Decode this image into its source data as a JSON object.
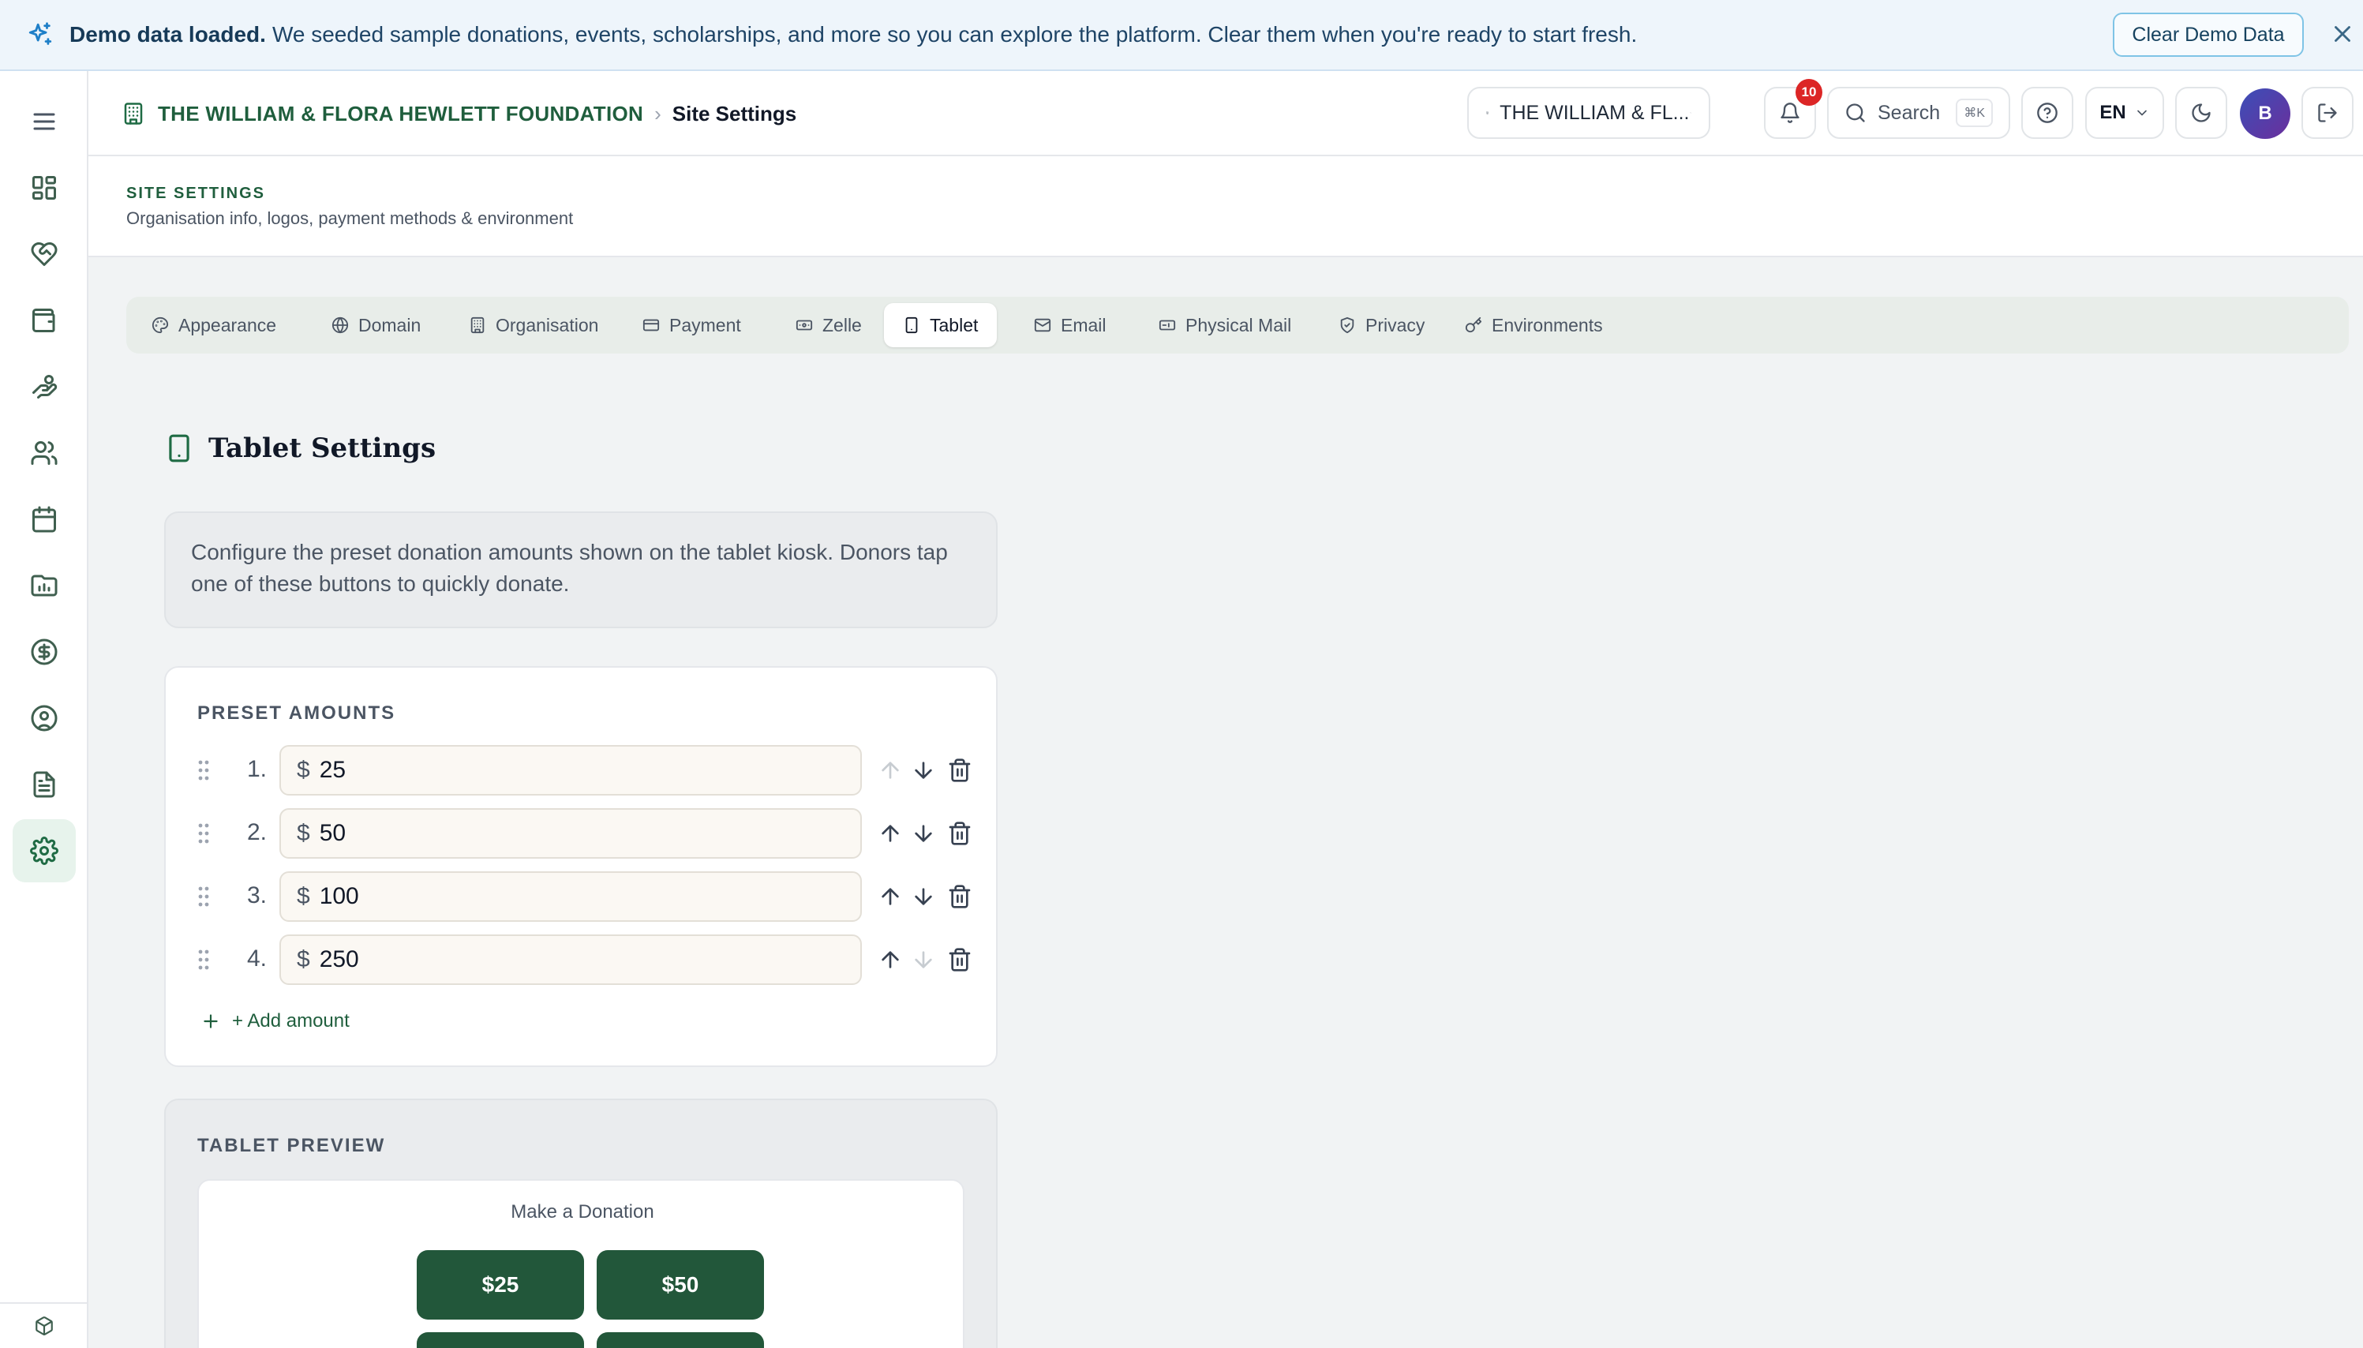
{
  "banner": {
    "title": "Demo data loaded.",
    "message": "We seeded sample donations, events, scholarships, and more so you can explore the platform. Clear them when you're ready to start fresh.",
    "clear_button": "Clear Demo Data"
  },
  "header": {
    "org_name": "THE WILLIAM & FLORA HEWLETT FOUNDATION",
    "separator": "›",
    "page": "Site Settings",
    "org_select": "THE WILLIAM & FL...",
    "notifications_count": "10",
    "search_label": "Search",
    "search_shortcut": "⌘K",
    "language": "EN",
    "avatar_initial": "B"
  },
  "page_header": {
    "title": "SITE SETTINGS",
    "subtitle": "Organisation info, logos, payment methods & environment"
  },
  "tabs": [
    {
      "label": "Appearance",
      "icon": "palette-icon"
    },
    {
      "label": "Domain",
      "icon": "globe-icon"
    },
    {
      "label": "Organisation",
      "icon": "building-icon"
    },
    {
      "label": "Payment",
      "icon": "credit-card-icon"
    },
    {
      "label": "Zelle",
      "icon": "banknote-icon"
    },
    {
      "label": "Tablet",
      "icon": "tablet-icon",
      "active": true
    },
    {
      "label": "Email",
      "icon": "mail-icon"
    },
    {
      "label": "Physical Mail",
      "icon": "mailbox-icon"
    },
    {
      "label": "Privacy",
      "icon": "shield-icon"
    },
    {
      "label": "Environments",
      "icon": "key-icon"
    }
  ],
  "tablet": {
    "title": "Tablet Settings",
    "description": "Configure the preset donation amounts shown on the tablet kiosk. Donors tap one of these buttons to quickly donate.",
    "preset_label": "PRESET AMOUNTS",
    "currency": "$",
    "amounts": [
      {
        "index": "1.",
        "value": "25"
      },
      {
        "index": "2.",
        "value": "50"
      },
      {
        "index": "3.",
        "value": "100"
      },
      {
        "index": "4.",
        "value": "250"
      }
    ],
    "add_label": "+ Add amount",
    "preview_label": "TABLET PREVIEW",
    "preview_heading": "Make a Donation",
    "preview_buttons": [
      "$25",
      "$50"
    ]
  },
  "colors": {
    "accent": "#1f6b44",
    "preview_button": "#22573a",
    "badge": "#dc2626",
    "banner_bg": "#eef5fb"
  }
}
